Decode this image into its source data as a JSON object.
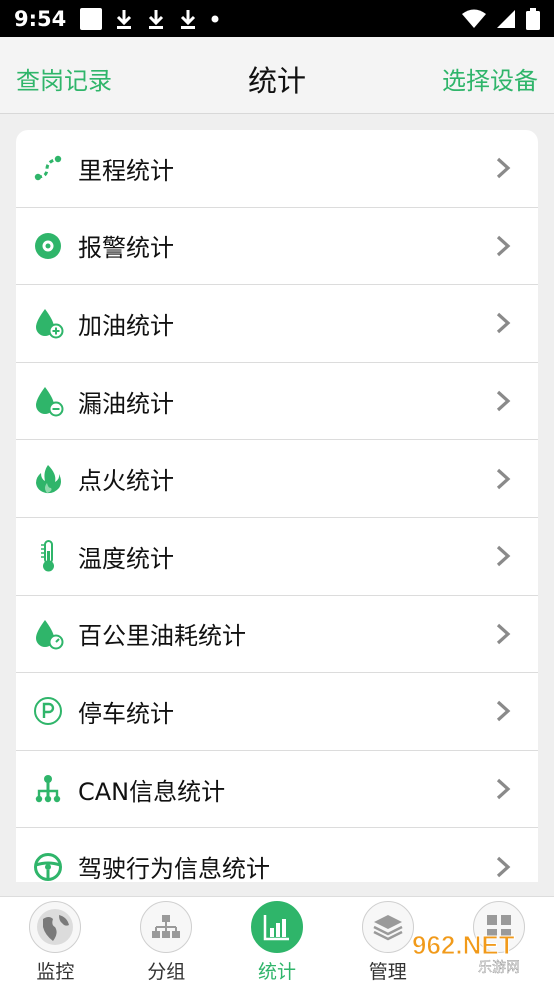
{
  "status_bar": {
    "time": "9:54"
  },
  "header": {
    "left_label": "查岗记录",
    "title": "统计",
    "right_label": "选择设备"
  },
  "list": {
    "items": [
      {
        "label": "里程统计",
        "icon": "route-icon"
      },
      {
        "label": "报警统计",
        "icon": "alarm-icon"
      },
      {
        "label": "加油统计",
        "icon": "fuel-add-icon"
      },
      {
        "label": "漏油统计",
        "icon": "fuel-leak-icon"
      },
      {
        "label": "点火统计",
        "icon": "fire-icon"
      },
      {
        "label": "温度统计",
        "icon": "thermometer-icon"
      },
      {
        "label": "百公里油耗统计",
        "icon": "fuel-consumption-icon"
      },
      {
        "label": "停车统计",
        "icon": "parking-icon"
      },
      {
        "label": "CAN信息统计",
        "icon": "can-network-icon"
      },
      {
        "label": "驾驶行为信息统计",
        "icon": "steering-wheel-icon"
      }
    ]
  },
  "bottom_nav": {
    "items": [
      {
        "label": "监控",
        "icon": "globe-icon"
      },
      {
        "label": "分组",
        "icon": "group-tree-icon"
      },
      {
        "label": "统计",
        "icon": "stats-chart-icon",
        "active": true
      },
      {
        "label": "管理",
        "icon": "layers-icon"
      },
      {
        "label": "",
        "icon": "apps-icon"
      }
    ]
  },
  "watermark": {
    "text": "962.NET",
    "subtext": "乐游网"
  },
  "colors": {
    "accent": "#2fb56a",
    "text": "#111111",
    "background": "#efefef"
  }
}
